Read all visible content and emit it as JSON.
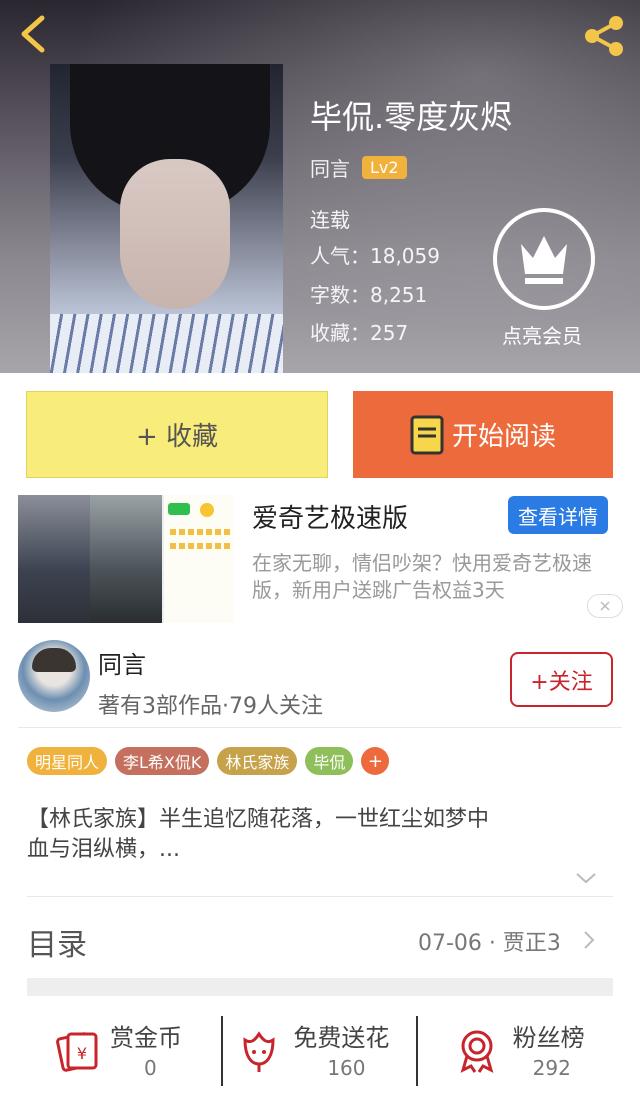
{
  "header": {
    "title": "毕侃.零度灰烬",
    "author": "同言",
    "level": "Lv2",
    "status": "连载",
    "popularity": "人气：18,059",
    "word_count": "字数：8,251",
    "favorites": "收藏：257",
    "vip_label": "点亮会员"
  },
  "actions": {
    "collect_label": "+ 收藏",
    "read_label": "开始阅读"
  },
  "ad": {
    "title": "爱奇艺极速版",
    "detail_button": "查看详情",
    "description": "在家无聊，情侣吵架？快用爱奇艺极速版，新用户送跳广告权益3天"
  },
  "author_card": {
    "name": "同言",
    "info": "著有3部作品·79人关注",
    "follow_label": "+关注"
  },
  "tags": [
    {
      "label": "明星同人",
      "color": "#f0b23c"
    },
    {
      "label": "李L希X侃K",
      "color": "#c5705f"
    },
    {
      "label": "林氏家族",
      "color": "#c6a24a"
    },
    {
      "label": "毕侃",
      "color": "#8fbf5a"
    }
  ],
  "tag_add_label": "+",
  "synopsis": "【林氏家族】半生追忆随花落，一世红尘如梦中\n血与泪纵横，...",
  "toc": {
    "label": "目录",
    "latest": "07-06 · 贾正3"
  },
  "bottom_bar": [
    {
      "title": "赏金币",
      "value": "0",
      "icon": "coin-envelope-icon"
    },
    {
      "title": "免费送花",
      "value": "160",
      "icon": "flower-icon"
    },
    {
      "title": "粉丝榜",
      "value": "292",
      "icon": "medal-icon"
    }
  ],
  "colors": {
    "collect_bg": "#f8ec7b",
    "read_bg": "#ec6a3b",
    "follow": "#c8242b",
    "ad_button": "#2a7be4",
    "icon_red": "#c8242b"
  }
}
